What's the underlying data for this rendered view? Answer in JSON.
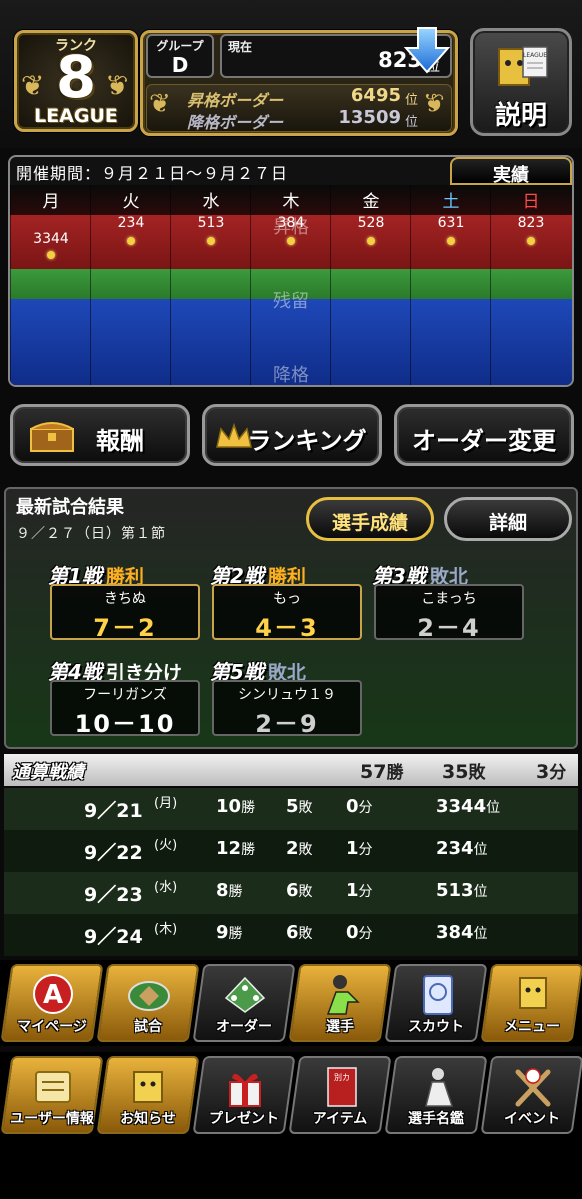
{
  "rank": {
    "label": "ランク",
    "number": "8",
    "league": "LEAGUE"
  },
  "group": {
    "label": "グループ",
    "value": "D"
  },
  "current": {
    "label": "現在",
    "value": "823",
    "unit": "位"
  },
  "borders": {
    "promote": {
      "label": "昇格ボーダー",
      "value": "6495",
      "unit": "位"
    },
    "demote": {
      "label": "降格ボーダー",
      "value": "13509",
      "unit": "位"
    }
  },
  "help_button": "説明",
  "help_icon_text": "LEAGUE",
  "schedule": {
    "period": "開催期間：９月２１日〜９月２７日",
    "results_tab": "実績",
    "days": [
      {
        "name": "月",
        "value": "3344",
        "color": "#ffffff"
      },
      {
        "name": "火",
        "value": "234",
        "color": "#ffffff"
      },
      {
        "name": "水",
        "value": "513",
        "color": "#ffffff"
      },
      {
        "name": "木",
        "value": "384",
        "color": "#ffffff"
      },
      {
        "name": "金",
        "value": "528",
        "color": "#ffffff"
      },
      {
        "name": "土",
        "value": "631",
        "color": "#6cc6ff"
      },
      {
        "name": "日",
        "value": "823",
        "color": "#ff4a4a"
      }
    ],
    "band_labels": {
      "promote": "昇格",
      "stay": "残留",
      "demote": "降格"
    }
  },
  "buttons": {
    "reward": "報酬",
    "ranking": "ランキング",
    "order": "オーダー変更"
  },
  "latest": {
    "title": "最新試合結果",
    "date": "９／２７（日）第１節",
    "player_stats": "選手成績",
    "detail": "詳細",
    "games": [
      {
        "num": "第1戦",
        "result": "勝利",
        "opponent": "きちぬ",
        "score": "7－2",
        "outcome": "win"
      },
      {
        "num": "第2戦",
        "result": "勝利",
        "opponent": "もっ",
        "score": "4－3",
        "outcome": "win"
      },
      {
        "num": "第3戦",
        "result": "敗北",
        "opponent": "こまっち",
        "score": "2－4",
        "outcome": "loss"
      },
      {
        "num": "第4戦",
        "result": "引き分け",
        "opponent": "フーリガンズ",
        "score": "10－10",
        "outcome": "draw"
      },
      {
        "num": "第5戦",
        "result": "敗北",
        "opponent": "シンリュウ１９",
        "score": "2－9",
        "outcome": "loss"
      }
    ]
  },
  "totals": {
    "title": "通算戦績",
    "wins": "57",
    "wins_unit": "勝",
    "losses": "35",
    "losses_unit": "敗",
    "draws": "3",
    "draws_unit": "分",
    "rows": [
      {
        "date": "9／21",
        "dow": "(月)",
        "w": "10",
        "l": "5",
        "d": "0",
        "rank": "3344"
      },
      {
        "date": "9／22",
        "dow": "(火)",
        "w": "12",
        "l": "2",
        "d": "1",
        "rank": "234"
      },
      {
        "date": "9／23",
        "dow": "(水)",
        "w": "8",
        "l": "6",
        "d": "1",
        "rank": "513"
      },
      {
        "date": "9／24",
        "dow": "(木)",
        "w": "9",
        "l": "6",
        "d": "0",
        "rank": "384"
      }
    ],
    "w_unit": "勝",
    "l_unit": "敗",
    "d_unit": "分",
    "rank_unit": "位"
  },
  "nav_main": [
    {
      "label": "マイページ",
      "icon": "a-letter-icon",
      "icon_text": "A"
    },
    {
      "label": "試合",
      "icon": "stadium-icon"
    },
    {
      "label": "オーダー",
      "icon": "field-order-icon"
    },
    {
      "label": "選手",
      "icon": "pitcher-icon"
    },
    {
      "label": "スカウト",
      "icon": "scout-card-icon"
    },
    {
      "label": "メニュー",
      "icon": "mascot-icon"
    }
  ],
  "nav_sub": [
    {
      "label": "ユーザー情報",
      "icon": "user-info-icon"
    },
    {
      "label": "お知らせ",
      "icon": "notice-icon"
    },
    {
      "label": "プレゼント",
      "icon": "gift-icon"
    },
    {
      "label": "アイテム",
      "icon": "item-book-icon",
      "badge": "別カ"
    },
    {
      "label": "選手名鑑",
      "icon": "player-directory-icon"
    },
    {
      "label": "イベント",
      "icon": "event-bats-icon"
    }
  ],
  "colors": {
    "gold": "#c9a44a",
    "win": "#ffb020",
    "loss": "#9aa8c8",
    "draw": "#ffffff"
  }
}
